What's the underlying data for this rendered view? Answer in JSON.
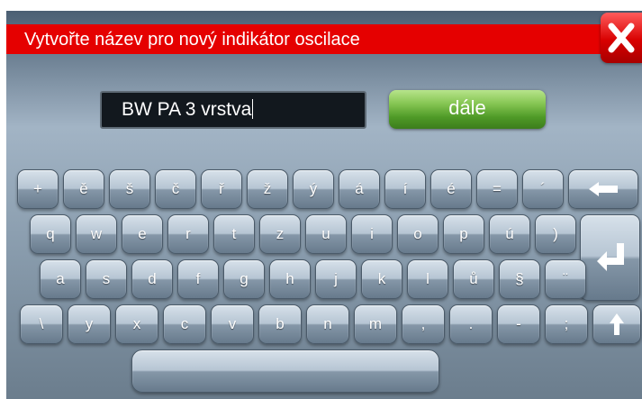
{
  "dialog": {
    "title": "Vytvořte název pro nový indikátor oscilace",
    "close_icon": "close-x-icon",
    "accent_color": "#e50000"
  },
  "name_input": {
    "value": "BW PA 3 vrstva"
  },
  "next_button": {
    "label": "dále",
    "color": "#6db23a"
  },
  "keyboard": {
    "row1": [
      "+",
      "ě",
      "š",
      "č",
      "ř",
      "ž",
      "ý",
      "á",
      "í",
      "é",
      "=",
      "´"
    ],
    "row2": [
      "q",
      "w",
      "e",
      "r",
      "t",
      "z",
      "u",
      "i",
      "o",
      "p",
      "ú",
      ")"
    ],
    "row3": [
      "a",
      "s",
      "d",
      "f",
      "g",
      "h",
      "j",
      "k",
      "l",
      "ů",
      "§",
      "¨"
    ],
    "row4": [
      "\\",
      "y",
      "x",
      "c",
      "v",
      "b",
      "n",
      "m",
      ",",
      ".",
      "-",
      ";"
    ],
    "special_icons": {
      "backspace": "arrow-left-icon",
      "enter": "enter-icon",
      "shift": "arrow-up-icon",
      "space": "space-bar"
    }
  }
}
